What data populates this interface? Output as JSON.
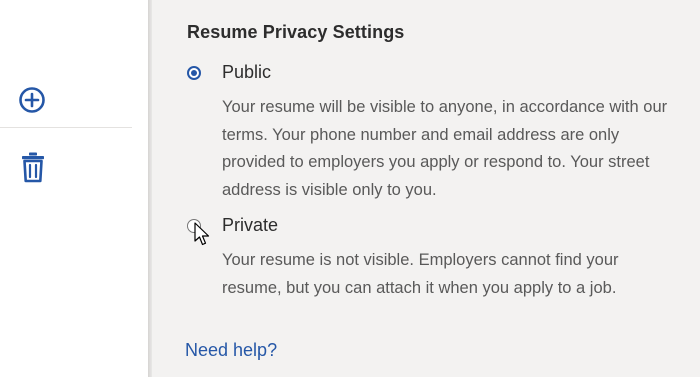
{
  "sidebar": {
    "add_icon": "plus-circle-icon",
    "delete_icon": "trash-icon",
    "accent_color": "#2557a7"
  },
  "privacy": {
    "title": "Resume Privacy Settings",
    "options": [
      {
        "label": "Public",
        "selected": true,
        "description": "Your resume will be visible to anyone, in accordance with our terms. Your phone number and email address are only provided to employers you apply or respond to. Your street address is visible only to you."
      },
      {
        "label": "Private",
        "selected": false,
        "description": "Your resume is not visible. Employers cannot find your resume, but you can attach it when you apply to a job."
      }
    ],
    "help_link": "Need help?"
  },
  "colors": {
    "panel_bg": "#f3f2f1",
    "link": "#2557a7",
    "heading": "#2d2d2d",
    "body_text": "#595959"
  }
}
